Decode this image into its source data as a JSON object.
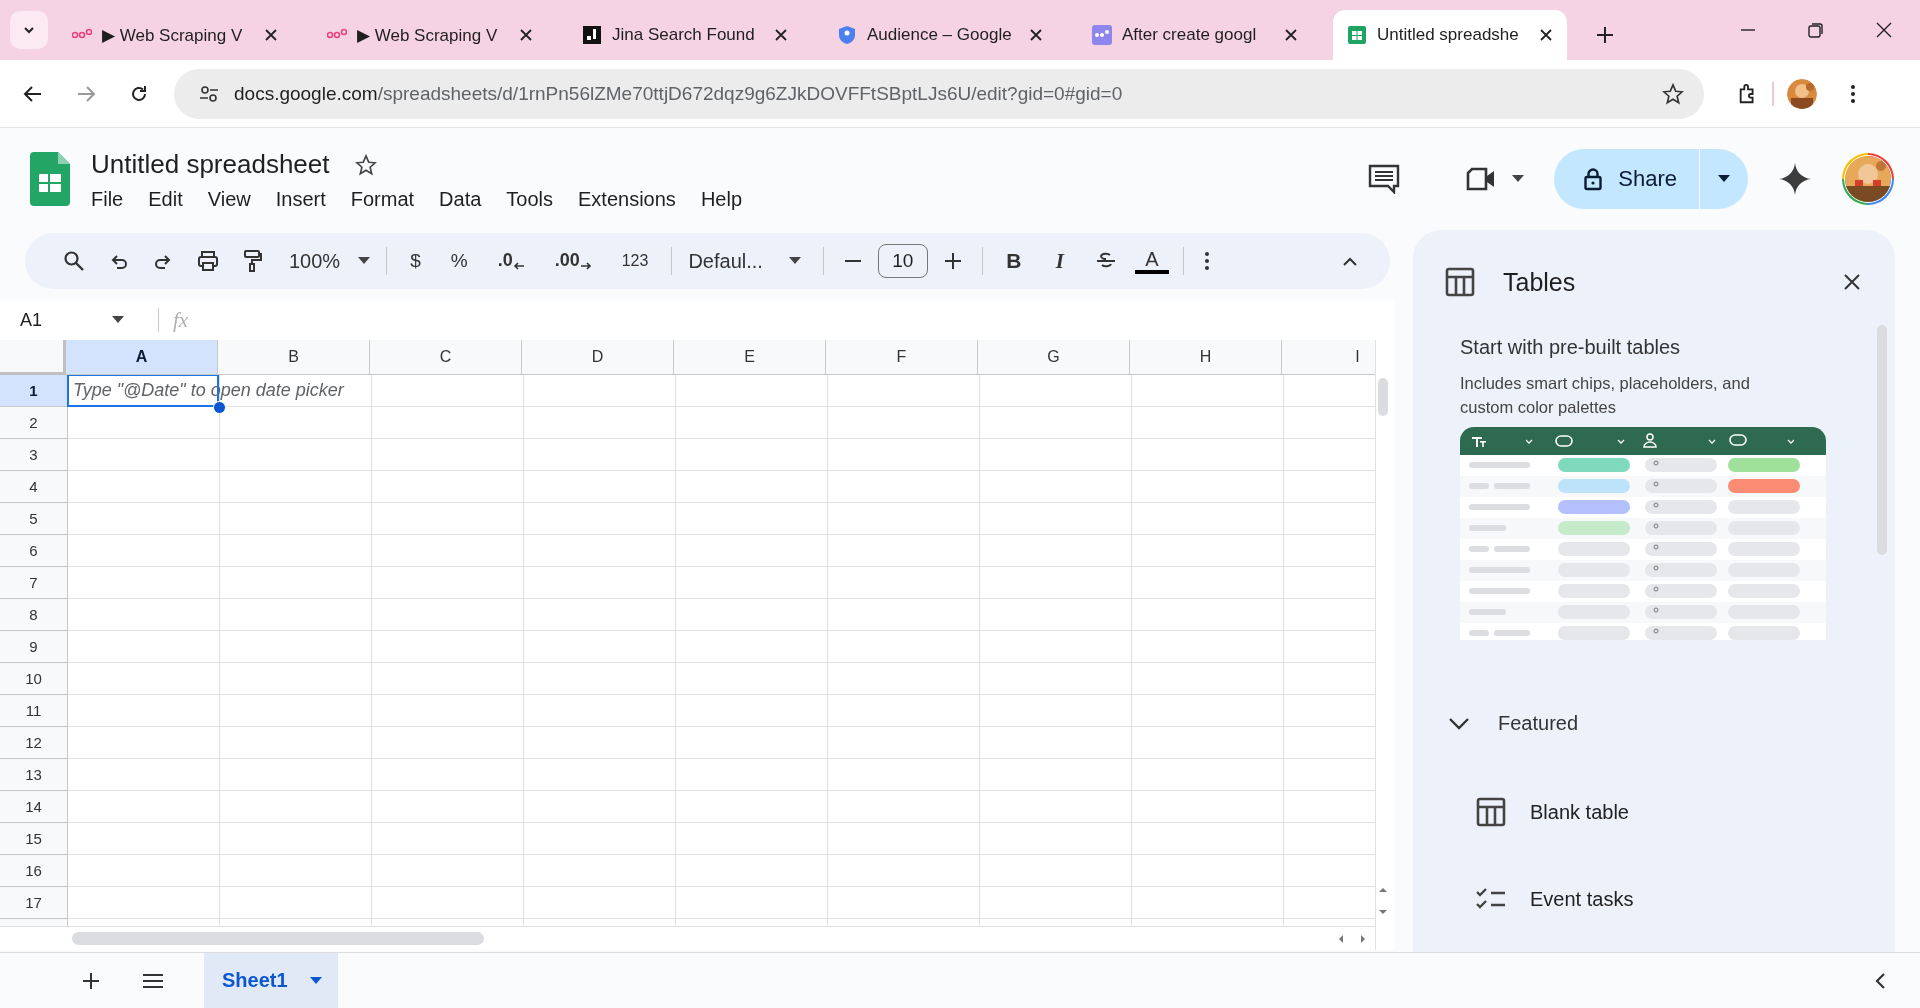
{
  "browser": {
    "tabs": [
      {
        "title": "▶ Web Scraping V",
        "selected": false
      },
      {
        "title": "▶ Web Scraping V",
        "selected": false
      },
      {
        "title": "Jina Search Found",
        "selected": false
      },
      {
        "title": "Audience – Google",
        "selected": false
      },
      {
        "title": "After create googl",
        "selected": false
      },
      {
        "title": "Untitled spreadshe",
        "selected": true
      }
    ],
    "url_host": "docs.google.com",
    "url_path": "/spreadsheets/d/1rnPn56lZMe70ttjD672dqz9g6ZJkDOVFFtSBptLJs6U/edit?gid=0#gid=0"
  },
  "doc": {
    "title": "Untitled spreadsheet",
    "menus": [
      "File",
      "Edit",
      "View",
      "Insert",
      "Format",
      "Data",
      "Tools",
      "Extensions",
      "Help"
    ],
    "share_label": "Share"
  },
  "toolbar": {
    "zoom": "100%",
    "currency": "$",
    "percent": "%",
    "decrease_decimals": ".0",
    "increase_decimals": ".00",
    "number_format": "123",
    "font": "Defaul...",
    "font_size": "10",
    "bold": "B",
    "italic": "I",
    "text_color": "A"
  },
  "formula_bar": {
    "cell_ref": "A1",
    "fx": "fx"
  },
  "grid": {
    "columns": [
      {
        "label": "A",
        "selected": true
      },
      {
        "label": "B",
        "selected": false
      },
      {
        "label": "C",
        "selected": false
      },
      {
        "label": "D",
        "selected": false
      },
      {
        "label": "E",
        "selected": false
      },
      {
        "label": "F",
        "selected": false
      },
      {
        "label": "G",
        "selected": false
      },
      {
        "label": "H",
        "selected": false
      },
      {
        "label": "I",
        "selected": false
      }
    ],
    "rows": [
      {
        "label": "1",
        "selected": true
      },
      {
        "label": "2",
        "selected": false
      },
      {
        "label": "3",
        "selected": false
      },
      {
        "label": "4",
        "selected": false
      },
      {
        "label": "5",
        "selected": false
      },
      {
        "label": "6",
        "selected": false
      },
      {
        "label": "7",
        "selected": false
      },
      {
        "label": "8",
        "selected": false
      },
      {
        "label": "9",
        "selected": false
      },
      {
        "label": "10",
        "selected": false
      },
      {
        "label": "11",
        "selected": false
      },
      {
        "label": "12",
        "selected": false
      },
      {
        "label": "13",
        "selected": false
      },
      {
        "label": "14",
        "selected": false
      },
      {
        "label": "15",
        "selected": false
      },
      {
        "label": "16",
        "selected": false
      },
      {
        "label": "17",
        "selected": false
      }
    ],
    "cell_hint": "Type \"@Date\" to open date picker"
  },
  "sheets": [
    {
      "name": "Sheet1",
      "selected": true
    }
  ],
  "panel": {
    "title": "Tables",
    "heading": "Start with pre-built tables",
    "description": "Includes smart chips, placeholders, and custom color palettes",
    "section": {
      "label": "Featured",
      "expanded": true
    },
    "items": [
      {
        "label": "Blank table",
        "kind": "table"
      },
      {
        "label": "Event tasks",
        "kind": "checklist"
      }
    ]
  }
}
